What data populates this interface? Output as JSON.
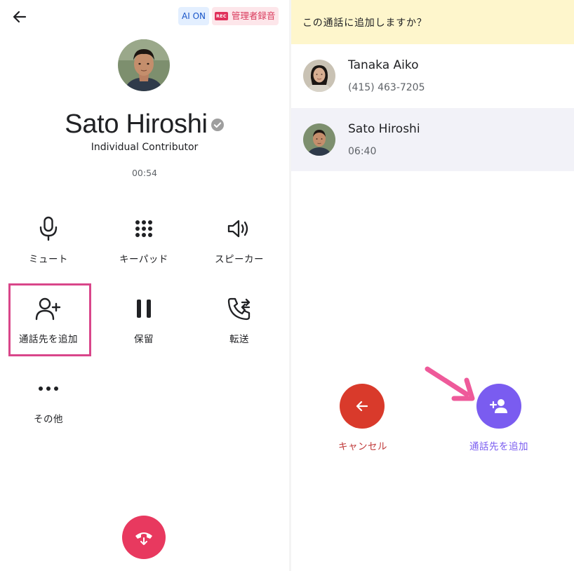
{
  "call": {
    "ai_badge": "AI ON",
    "rec_mark": "REC",
    "rec_label": "管理者録音",
    "caller_name": "Sato Hiroshi",
    "caller_role": "Individual Contributor",
    "timer": "00:54"
  },
  "controls": [
    {
      "label": "ミュート",
      "icon": "microphone-icon"
    },
    {
      "label": "キーパッド",
      "icon": "keypad-icon"
    },
    {
      "label": "スピーカー",
      "icon": "speaker-icon"
    },
    {
      "label": "通話先を追加",
      "icon": "add-person-icon"
    },
    {
      "label": "保留",
      "icon": "pause-icon"
    },
    {
      "label": "転送",
      "icon": "transfer-call-icon"
    },
    {
      "label": "その他",
      "icon": "more-icon"
    }
  ],
  "add_panel": {
    "prompt": "この通話に追加しますか？",
    "contacts": [
      {
        "name": "Tanaka Aiko",
        "detail": "(415) 463-7205"
      },
      {
        "name": "Sato Hiroshi",
        "detail": "06:40"
      }
    ],
    "cancel_label": "キャンセル",
    "add_label": "通話先を追加"
  },
  "colors": {
    "end_call": "#e8395f",
    "highlight": "#d9468a",
    "cancel": "#d93a2b",
    "add": "#7a5cf0",
    "banner": "#fef6cc",
    "selected_row": "#f2f2f8"
  }
}
